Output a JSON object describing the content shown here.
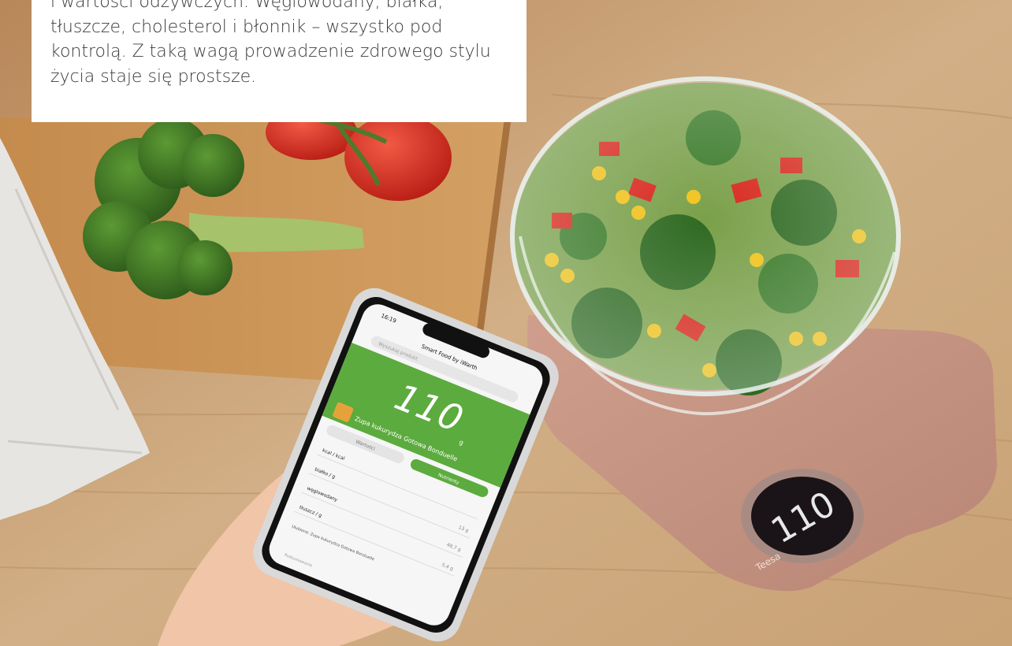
{
  "caption": {
    "text": "i wartości odżywczych. Węglowodany, białka, tłuszcze, cholesterol i błonnik – wszystko pod kontrolą. Z taką wagą prowadzenie zdrowego stylu życia staje się prostsze."
  },
  "phone": {
    "time": "16:19",
    "app_title": "Smart Food by iWarth",
    "search_placeholder": "Wyszukaj produkt",
    "weight_value": "110",
    "weight_unit": "g",
    "product_name": "Zupa kukurydza Gotowa Bonduelle",
    "tabs": [
      "Wartości",
      "Nutrienty"
    ],
    "rows": [
      {
        "label": "kcal / kcal",
        "value": ""
      },
      {
        "label": "białko / g",
        "value": "13 g"
      },
      {
        "label": "węglowodany",
        "value": "48,7 g"
      },
      {
        "label": "tłuszcz / g",
        "value": "5,4 g"
      },
      {
        "label": "Ulubione: Zupa kukurydza Gotowa Bonduelle",
        "value": ""
      }
    ],
    "bottom_label": "Podsumowanie"
  },
  "scale": {
    "display_value": "110",
    "brand": "Teesa"
  },
  "colors": {
    "app_green": "#5cab3e",
    "board": "#c8955a",
    "table": "#d4b287",
    "scale_body": "#c79383"
  }
}
